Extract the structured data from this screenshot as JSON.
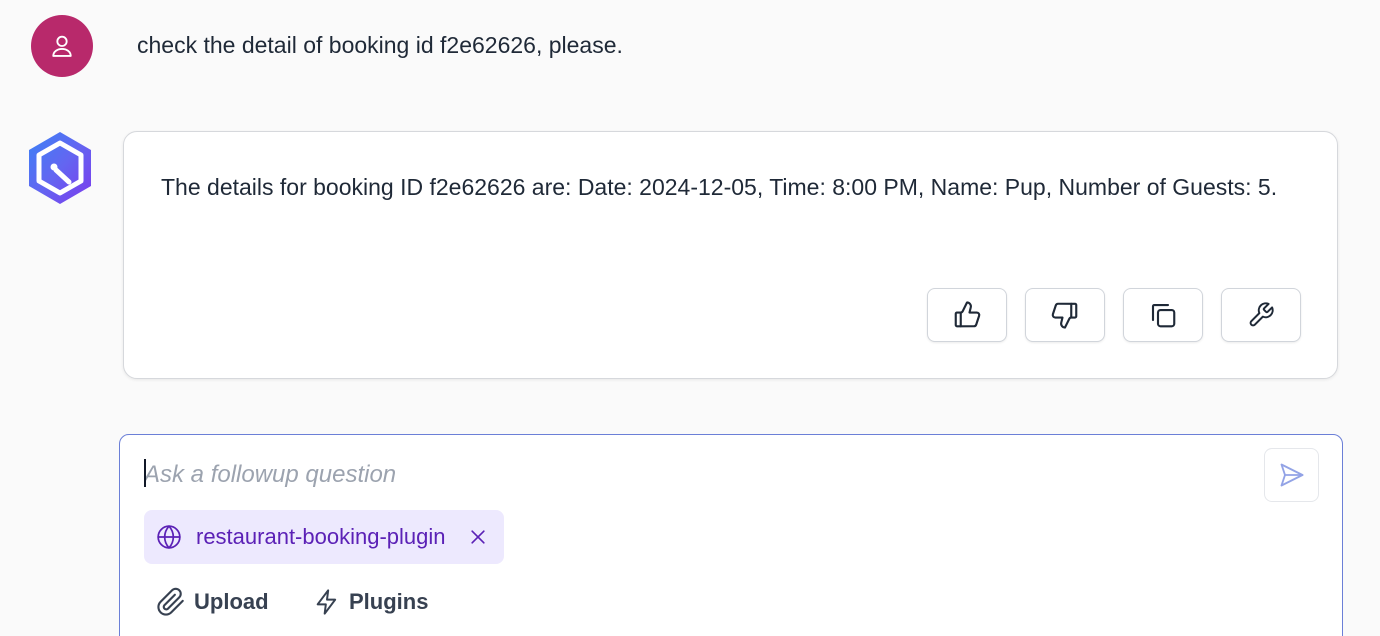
{
  "user_message": {
    "avatar_icon": "user-icon",
    "avatar_color": "#b8296b",
    "text": "check the detail of booking id f2e62626, please."
  },
  "assistant_message": {
    "avatar_icon": "assistant-logo-icon",
    "text": "The details for booking ID f2e62626 are: Date: 2024-12-05, Time: 8:00 PM, Name: Pup, Number of Guests: 5.",
    "actions": [
      {
        "name": "thumbs-up-button",
        "icon": "thumbs-up-icon"
      },
      {
        "name": "thumbs-down-button",
        "icon": "thumbs-down-icon"
      },
      {
        "name": "copy-button",
        "icon": "copy-icon"
      },
      {
        "name": "tool-button",
        "icon": "wrench-icon"
      }
    ]
  },
  "composer": {
    "placeholder": "Ask a followup question",
    "value": "",
    "send_icon": "send-icon",
    "plugin_chip": {
      "icon": "globe-icon",
      "label": "restaurant-booking-plugin",
      "remove_icon": "close-icon"
    },
    "upload_label": "Upload",
    "upload_icon": "paperclip-icon",
    "plugins_label": "Plugins",
    "plugins_icon": "lightning-icon",
    "border_color": "#6b7fd7",
    "chip_color": "#5b21b6"
  }
}
